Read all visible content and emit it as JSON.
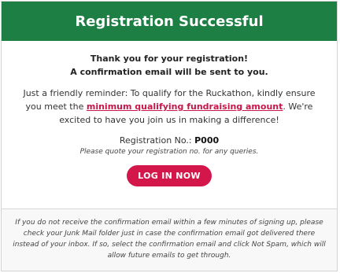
{
  "header": {
    "title": "Registration Successful",
    "bg_color": "#1e7f45"
  },
  "thanks": {
    "line1": "Thank you for your registration!",
    "line2": "A confirmation email will be sent to you."
  },
  "reminder": {
    "before_link": "Just a friendly reminder: To qualify for the Ruckathon, kindly ensure you meet the ",
    "link_text": "minimum qualifying fundraising amount",
    "after_link": ". We're excited to have you join us in making a difference!"
  },
  "registration": {
    "label": "Registration No.: ",
    "number": "P000",
    "note": "Please quote your registration no. for any queries."
  },
  "actions": {
    "login_label": "LOG IN NOW",
    "button_color": "#d3174a"
  },
  "footer": {
    "note": "If you do not receive the confirmation email within a few minutes of signing up, please check your Junk Mail folder just in case the confirmation email got delivered there instead of your inbox. If so, select the confirmation email and click Not Spam, which will allow future emails to get through."
  }
}
